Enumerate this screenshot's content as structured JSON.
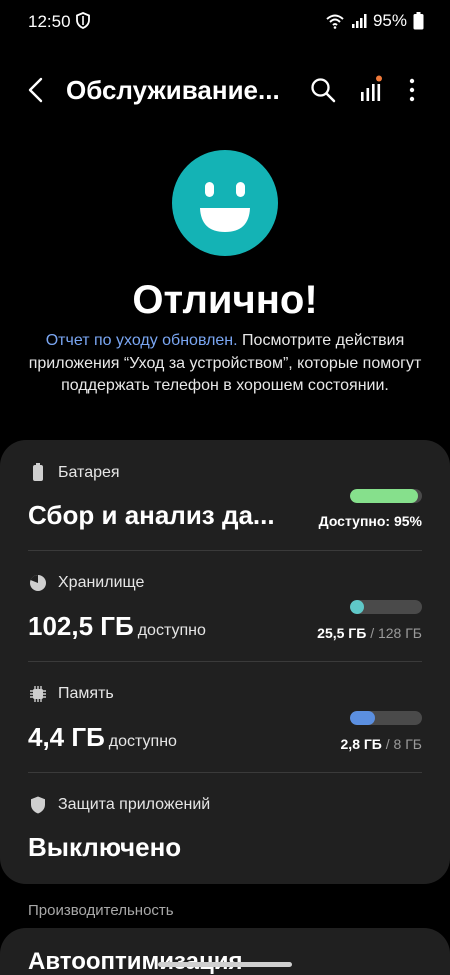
{
  "status_bar": {
    "time": "12:50",
    "battery_text": "95%"
  },
  "app_bar": {
    "title": "Обслуживание...",
    "icons": [
      "back-icon",
      "search-icon",
      "stats-icon",
      "more-icon"
    ]
  },
  "hero": {
    "title": "Отлично!",
    "link_text": "Отчет по уходу обновлен.",
    "description": " Посмотрите действия приложения “Уход за устройством”, которые помогут поддержать телефон в хорошем состоянии."
  },
  "battery": {
    "label": "Батарея",
    "value": "Сбор и анализ да...",
    "available": "Доступно: 95%",
    "level_percent": 95,
    "color": "#86e08c"
  },
  "storage": {
    "label": "Хранилище",
    "value": "102,5 ГБ",
    "unit": "доступно",
    "used": "25,5 ГБ",
    "total": " / 128 ГБ",
    "used_fraction": 0.2,
    "color": "#5fc8c8"
  },
  "memory": {
    "label": "Память",
    "value": "4,4 ГБ",
    "unit": "доступно",
    "used": "2,8 ГБ",
    "total": " / 8 ГБ",
    "used_fraction": 0.35,
    "color": "#5b8fe0"
  },
  "app_protection": {
    "label": "Защита приложений",
    "value": "Выключено"
  },
  "performance": {
    "section_label": "Производительность",
    "item_label": "Автооптимизация"
  },
  "colors": {
    "accent_teal": "#14b3b5",
    "link_blue": "#7aa6f2",
    "notification_dot": "#f07a3a"
  }
}
